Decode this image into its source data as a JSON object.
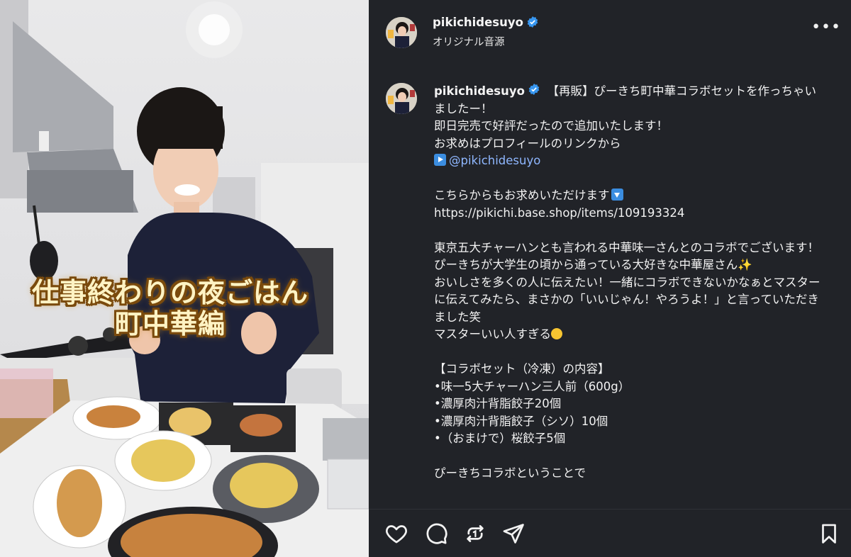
{
  "media": {
    "overlay_line1": "仕事終わりの夜ごはん",
    "overlay_line2": "町中華編"
  },
  "header": {
    "username": "pikichidesuyo",
    "audio": "オリジナル音源",
    "verified": true,
    "more_icon": "more-horizontal-icon"
  },
  "caption": {
    "username": "pikichidesuyo",
    "line01": "【再販】ぴーきち町中華コラボセットを作っちゃいましたー！",
    "line02": "即日完売で好評だったので追加いたします！",
    "line03": "お求めはプロフィールのリンクから",
    "mention": "@pikichidesuyo",
    "line04": "こちらからもお求めいただけます",
    "link": "https://pikichi.base.shop/items/109193324",
    "line05": "東京五大チャーハンとも言われる中華味一さんとのコラボでございます！",
    "line06": "ぴーきちが大学生の頃から通っている大好きな中華屋さん",
    "line07": "おいしさを多くの人に伝えたい！一緒にコラボできないかなぁとマスターに伝えてみたら、まさかの「いいじゃん！やろうよ！」と言っていただきました笑",
    "line08": "マスターいい人すぎる",
    "line09": "【コラボセット（冷凍）の内容】",
    "line10": "•味一5大チャーハン三人前（600g）",
    "line11": "•濃厚肉汁背脂餃子20個",
    "line12": "•濃厚肉汁背脂餃子（シソ）10個",
    "line13": "•（おまけで）桜餃子5個",
    "line14": "ぴーきちコラボということで"
  },
  "actions": {
    "like": "heart-icon",
    "comment": "comment-icon",
    "repost": "repost-icon",
    "share": "send-icon",
    "save": "bookmark-icon"
  },
  "colors": {
    "background": "#212328",
    "mention": "#8fb7ff",
    "verified": "#3897f0"
  }
}
